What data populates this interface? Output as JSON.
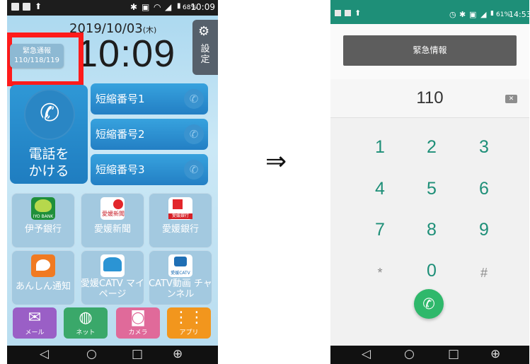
{
  "left_phone": {
    "status_bar": {
      "battery": "68%",
      "time": "10:09"
    },
    "date_main": "2019/10/03",
    "date_day": "(木)",
    "clock": "10:09",
    "settings_label": "設定",
    "emergency_line1": "緊急通報",
    "emergency_line2": "110/118/119",
    "call_line1": "電話を",
    "call_line2": "かける",
    "speed_dials": [
      "短縮番号1",
      "短縮番号2",
      "短縮番号3"
    ],
    "apps": [
      {
        "label": "伊予銀行",
        "icon_text": "IYO BANK",
        "icon": "iyo-bank-icon"
      },
      {
        "label": "愛媛新聞",
        "icon_text": "愛媛新聞",
        "icon": "ehime-shimbun-icon"
      },
      {
        "label": "愛媛銀行",
        "icon_text": "愛媛銀行",
        "icon": "ehime-bank-icon"
      },
      {
        "label": "あんしん通知",
        "icon_text": "",
        "icon": "anshin-icon"
      },
      {
        "label": "愛媛CATV マイページ",
        "icon_text": "",
        "icon": "catv-mypage-icon"
      },
      {
        "label": "CATV動画 チャンネル",
        "icon_text": "愛媛CATV",
        "icon": "catv-video-icon"
      }
    ],
    "dock": [
      {
        "label": "メール",
        "color": "#9a5fc6",
        "icon": "mail-icon"
      },
      {
        "label": "ネット",
        "color": "#3aa86a",
        "icon": "globe-icon"
      },
      {
        "label": "カメラ",
        "color": "#e06a9a",
        "icon": "camera-icon"
      },
      {
        "label": "アプリ",
        "color": "#f2961d",
        "icon": "apps-grid-icon"
      }
    ]
  },
  "arrow": "⇒",
  "right_phone": {
    "status_bar": {
      "battery": "61%",
      "time": "14:53"
    },
    "emergency_header": "緊急情報",
    "dialed_number": "110",
    "keys": [
      "1",
      "2",
      "3",
      "4",
      "5",
      "6",
      "7",
      "8",
      "9",
      "*",
      "0",
      "#"
    ]
  }
}
